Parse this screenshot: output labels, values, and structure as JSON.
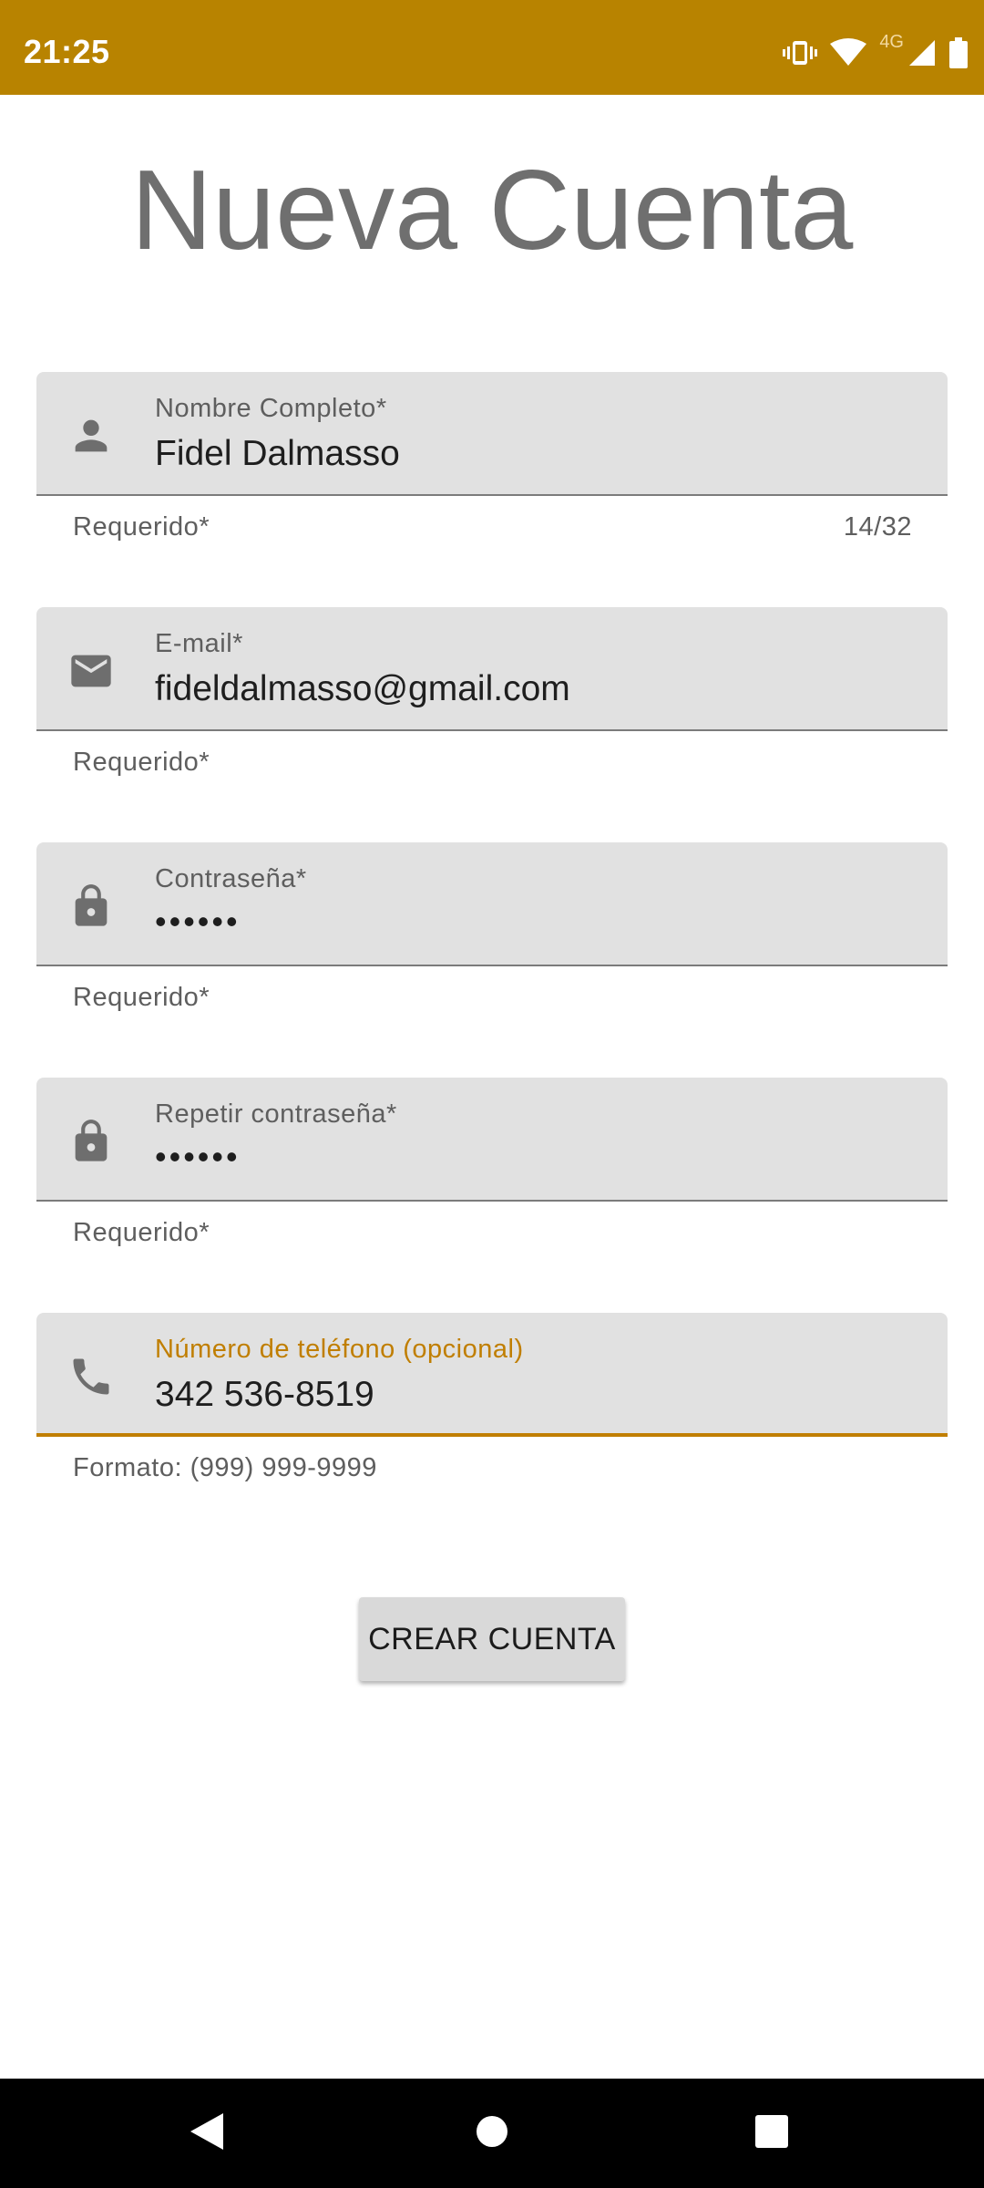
{
  "status_bar": {
    "time": "21:25",
    "network_label": "4G",
    "icons": [
      "vibrate-icon",
      "wifi-icon",
      "cell-signal-icon",
      "battery-icon"
    ]
  },
  "title": "Nueva Cuenta",
  "form": {
    "name": {
      "label": "Nombre Completo*",
      "value": "Fidel Dalmasso",
      "helper": "Requerido*",
      "counter": "14/32",
      "icon": "person-icon"
    },
    "email": {
      "label": "E-mail*",
      "value": "fideldalmasso@gmail.com",
      "helper": "Requerido*",
      "icon": "email-icon"
    },
    "password": {
      "label": "Contraseña*",
      "value": "••••••",
      "helper": "Requerido*",
      "icon": "lock-icon"
    },
    "repeat_password": {
      "label": "Repetir contraseña*",
      "value": "••••••",
      "helper": "Requerido*",
      "icon": "lock-icon"
    },
    "phone": {
      "label": "Número de teléfono (opcional)",
      "value": "342 536-8519",
      "helper": "Formato: (999) 999-9999",
      "icon": "phone-icon"
    }
  },
  "submit_button": "CREAR CUENTA",
  "colors": {
    "accent": "#b88300",
    "active_field": "#c07e00",
    "field_background": "#e1e1e1",
    "title": "#6f6f6f"
  },
  "nav_bar": [
    "back-icon",
    "home-icon",
    "recents-icon"
  ]
}
